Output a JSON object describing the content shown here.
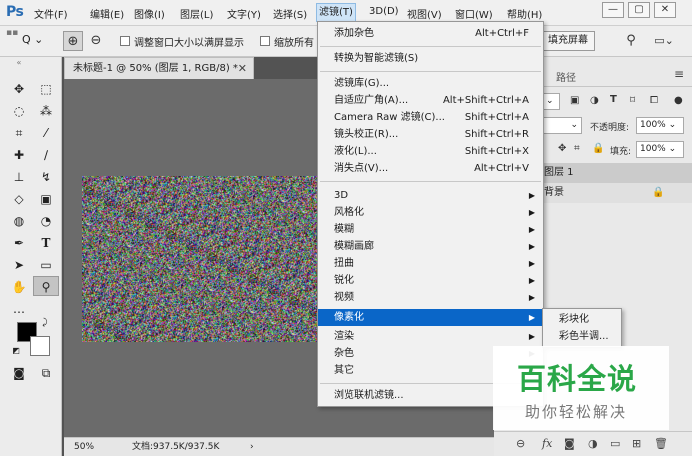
{
  "app": {
    "logo": "Ps"
  },
  "menubar": {
    "items": [
      "文件(F)",
      "编辑(E)",
      "图像(I)",
      "图层(L)",
      "文字(Y)",
      "选择(S)",
      "滤镜(T)",
      "3D(D)",
      "视图(V)",
      "窗口(W)",
      "帮助(H)"
    ],
    "active_item": "滤镜(T)",
    "window_controls": {
      "minimize": "—",
      "restore": "▢",
      "close": "✕"
    }
  },
  "options_bar": {
    "zoom_tool_dropdown": "Q ⌄",
    "resize_windows_label": "调整窗口大小以满屏显示",
    "zoom_all_label": "缩放所有",
    "fill_screen_button": "填充屏幕"
  },
  "document": {
    "tab_title": "未标题-1 @ 50% (图层 1, RGB/8) *",
    "close_glyph": "✕"
  },
  "status_bar": {
    "zoom": "50%",
    "doc_size": "文档:937.5K/937.5K",
    "arrow": "›"
  },
  "layers_panel": {
    "paths_tab": "路径",
    "opacity_label": "不透明度:",
    "opacity_value": "100%",
    "fill_label": "填充:",
    "fill_value": "100%",
    "layers": [
      {
        "name": "图层 1"
      },
      {
        "name": "背景"
      }
    ]
  },
  "filter_menu": {
    "top_items": [
      {
        "label": "添加杂色",
        "shortcut": "Alt+Ctrl+F"
      }
    ],
    "group2": [
      {
        "label": "转换为智能滤镜(S)",
        "shortcut": ""
      }
    ],
    "group3": [
      {
        "label": "滤镜库(G)...",
        "shortcut": ""
      },
      {
        "label": "自适应广角(A)...",
        "shortcut": "Alt+Shift+Ctrl+A"
      },
      {
        "label": "Camera Raw 滤镜(C)...",
        "shortcut": "Shift+Ctrl+A"
      },
      {
        "label": "镜头校正(R)...",
        "shortcut": "Shift+Ctrl+R"
      },
      {
        "label": "液化(L)...",
        "shortcut": "Shift+Ctrl+X"
      },
      {
        "label": "消失点(V)...",
        "shortcut": "Alt+Ctrl+V"
      }
    ],
    "group4": [
      {
        "label": "3D"
      },
      {
        "label": "风格化"
      },
      {
        "label": "模糊"
      },
      {
        "label": "模糊画廊"
      },
      {
        "label": "扭曲"
      },
      {
        "label": "锐化"
      },
      {
        "label": "视频"
      },
      {
        "label": "像素化"
      },
      {
        "label": "渲染"
      },
      {
        "label": "杂色"
      },
      {
        "label": "其它"
      }
    ],
    "highlighted": "像素化",
    "group5": [
      {
        "label": "浏览联机滤镜..."
      }
    ],
    "submenu_arrow": "▶"
  },
  "pixelate_submenu": {
    "items": [
      "彩块化",
      "彩色半调..."
    ]
  },
  "watermark": {
    "title": "百科全说",
    "subtitle": "助你轻松解决"
  },
  "colors": {
    "menu_highlight": "#0a66c8",
    "foreground_color": "#000000",
    "background_color": "#ffffff",
    "watermark_green": "#2aa748"
  }
}
